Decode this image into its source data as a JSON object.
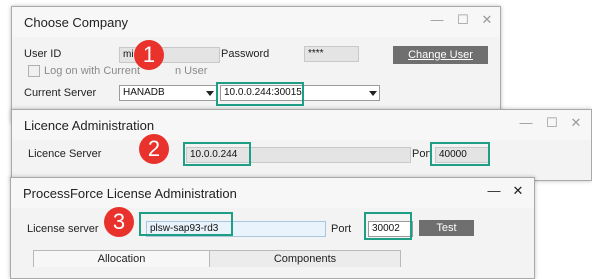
{
  "choose_company": {
    "title": "Choose Company",
    "user_id_label": "User ID",
    "user_id_value": "mi",
    "password_label": "Password",
    "password_value": "****",
    "change_user_button": "Change User",
    "logon_checkbox_label": "Log on with Current",
    "logon_checkbox_label_tail": "n User",
    "current_server_label": "Current Server",
    "current_server_value": "HANADB",
    "server_address_value": "10.0.0.244:30015"
  },
  "licence_admin": {
    "title": "Licence Administration",
    "licence_server_label": "Licence Server",
    "licence_server_value": "10.0.0.244",
    "port_label": "Port",
    "port_value": "40000"
  },
  "processforce_admin": {
    "title": "ProcessForce License Administration",
    "license_server_label": "License server",
    "license_server_value": "plsw-sap93-rd3",
    "port_label": "Port",
    "port_value": "30002",
    "test_button": "Test",
    "tabs": [
      "Allocation",
      "Components"
    ]
  },
  "badges": [
    "1",
    "2",
    "3"
  ],
  "colors": {
    "highlight": "#1f9e86",
    "badge": "#e8322b",
    "button": "#6f6f6f"
  }
}
